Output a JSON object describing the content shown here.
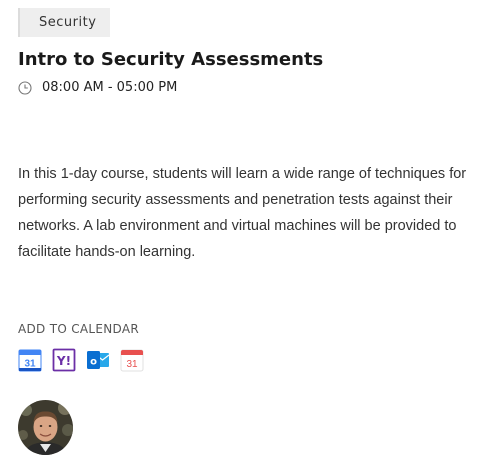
{
  "event": {
    "category": "Security",
    "title": "Intro to Security Assessments",
    "time": "08:00 AM - 05:00 PM",
    "description": "In this 1-day course, students will learn a wide range of techniques for performing security assessments and penetration tests against their networks. A lab environment and virtual machines will be provided to facilitate hands-on learning."
  },
  "calendar": {
    "heading": "ADD TO CALENDAR",
    "google_day": "31",
    "ical_day": "31",
    "outlook_letter": "o",
    "yahoo_letter": "Y!",
    "icons": [
      "google-calendar-icon",
      "yahoo-calendar-icon",
      "outlook-calendar-icon",
      "ical-calendar-icon"
    ]
  },
  "colors": {
    "google_blue": "#4285F4",
    "yahoo_purple": "#6b2fa6",
    "outlook_blue": "#0a6ed1",
    "ical_red": "#e8504f"
  }
}
